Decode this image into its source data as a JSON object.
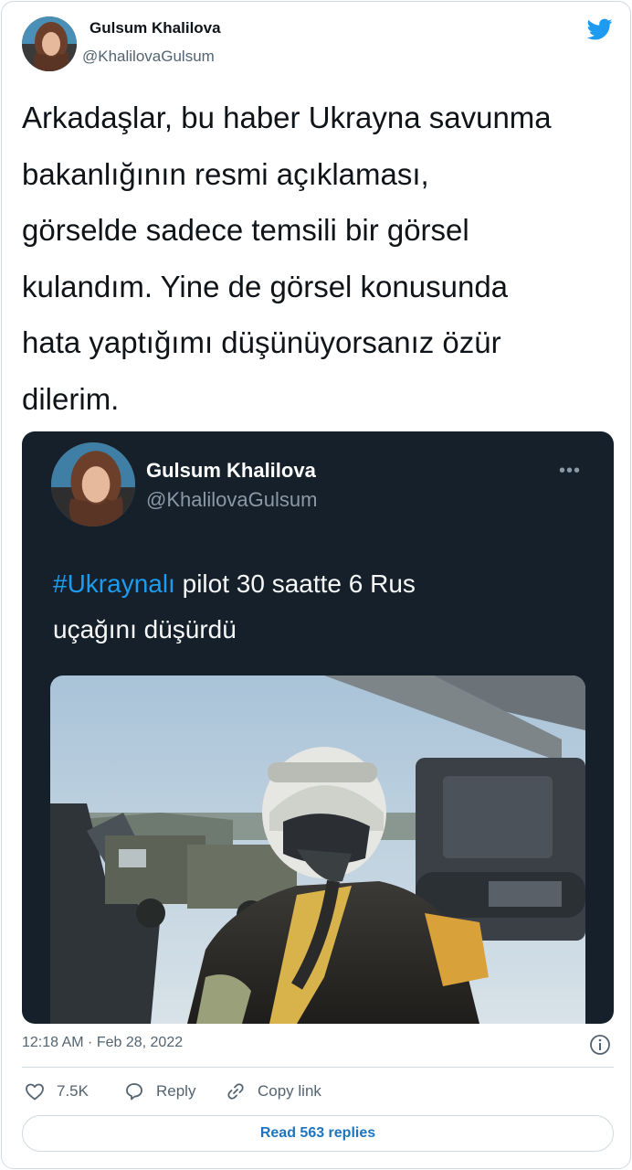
{
  "author": {
    "name": "Gulsum Khalilova",
    "handle": "@KhalilovaGulsum"
  },
  "tweet": {
    "lines": [
      "Arkadaşlar, bu haber Ukrayna savunma",
      "bakanlığının resmi açıklaması,",
      "görselde sadece temsili bir görsel",
      "kulandım. Yine de görsel konusunda",
      "hata yaptığımı düşünüyorsanız özür",
      "dilerim."
    ]
  },
  "quoted": {
    "name": "Gulsum Khalilova",
    "handle": "@KhalilovaGulsum",
    "more": "•••",
    "hashtag": "#Ukraynalı",
    "text_rest": " pilot 30 saatte 6 Rus",
    "text_line2": "uçağını düşürdü"
  },
  "meta": {
    "timestamp": "12:18 AM · Feb 28, 2022"
  },
  "actions": {
    "like_count": "7.5K",
    "reply_label": "Reply",
    "copy_label": "Copy link"
  },
  "read_replies": "Read 563 replies",
  "colors": {
    "twitter_blue": "#1d9bf0",
    "dark_bg": "#15202b",
    "muted": "#536471"
  },
  "icons": {
    "brand": "twitter-bird-icon",
    "like": "heart-icon",
    "reply": "speech-bubble-icon",
    "copy": "link-icon",
    "info": "info-icon"
  }
}
